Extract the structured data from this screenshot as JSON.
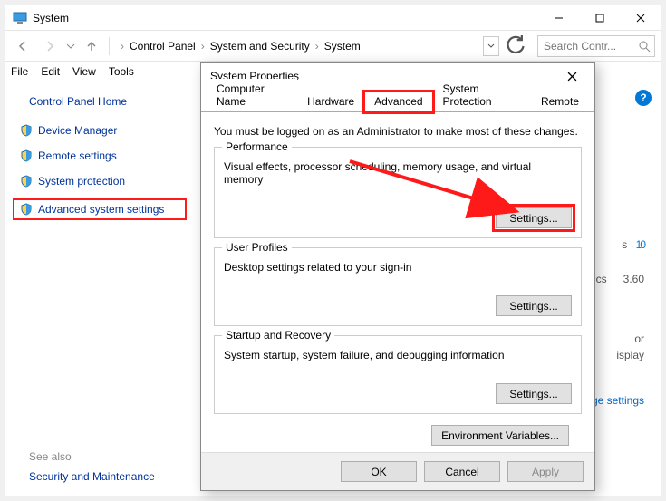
{
  "main": {
    "title": "System",
    "breadcrumbs": [
      "Control Panel",
      "System and Security",
      "System"
    ],
    "search_placeholder": "Search Contr...",
    "menus": [
      "File",
      "Edit",
      "View",
      "Tools"
    ],
    "sidebar": {
      "home": "Control Panel Home",
      "items": [
        {
          "label": "Device Manager"
        },
        {
          "label": "Remote settings"
        },
        {
          "label": "System protection"
        },
        {
          "label": "Advanced system settings",
          "highlighted": true
        }
      ],
      "seealso_heading": "See also",
      "seealso_link": "Security and Maintenance"
    },
    "background_fragments": {
      "os_fragment_right": "s 10",
      "row1_left": "nics",
      "row1_right": "3.60",
      "row2a": "or",
      "row2b": "isplay",
      "link_fragment": "nge settings"
    }
  },
  "dialog": {
    "title": "System Properties",
    "tabs": [
      "Computer Name",
      "Hardware",
      "Advanced",
      "System Protection",
      "Remote"
    ],
    "active_tab": 2,
    "note": "You must be logged on as an Administrator to make most of these changes.",
    "groups": {
      "performance": {
        "legend": "Performance",
        "desc": "Visual effects, processor scheduling, memory usage, and virtual memory",
        "button": "Settings..."
      },
      "userprofiles": {
        "legend": "User Profiles",
        "desc": "Desktop settings related to your sign-in",
        "button": "Settings..."
      },
      "startup": {
        "legend": "Startup and Recovery",
        "desc": "System startup, system failure, and debugging information",
        "button": "Settings..."
      }
    },
    "env_button": "Environment Variables...",
    "ok": "OK",
    "cancel": "Cancel",
    "apply": "Apply"
  }
}
